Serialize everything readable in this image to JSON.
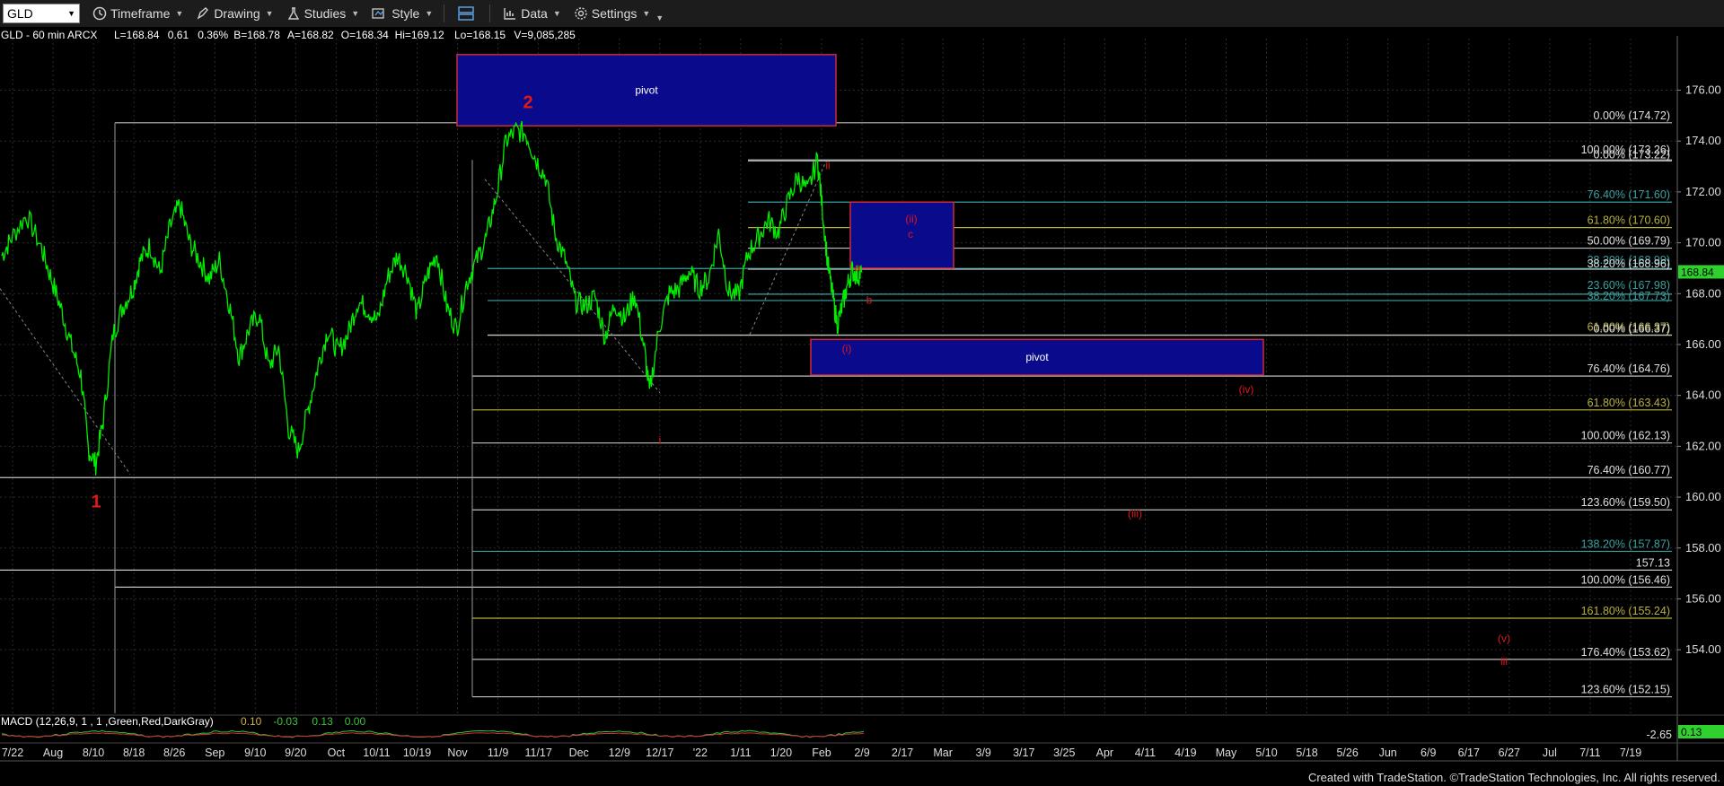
{
  "toolbar": {
    "symbol": "GLD",
    "items": [
      {
        "label": "Timeframe",
        "icon": "clock-icon"
      },
      {
        "label": "Drawing",
        "icon": "pen-icon"
      },
      {
        "label": "Studies",
        "icon": "flask-icon"
      },
      {
        "label": "Style",
        "icon": "style-icon"
      },
      {
        "label": "Data",
        "icon": "chart-icon"
      },
      {
        "label": "Settings",
        "icon": "gear-icon"
      }
    ]
  },
  "header": {
    "symbol_info": "GLD - 60 min  ARCX",
    "stats": [
      {
        "text": "L=168.84",
        "color": "#ffffff"
      },
      {
        "text": "0.61",
        "color": "#ffffff"
      },
      {
        "text": "0.36%",
        "color": "#ffffff"
      },
      {
        "text": "B=168.78",
        "color": "#ffffff"
      },
      {
        "text": "A=168.82",
        "color": "#ffffff"
      },
      {
        "text": "O=168.34",
        "color": "#ffffff"
      },
      {
        "text": "Hi=169.12",
        "color": "#ffffff"
      },
      {
        "text": "Lo=168.15",
        "color": "#ffffff"
      },
      {
        "text": "V=9,085,285",
        "color": "#ffffff"
      }
    ]
  },
  "footer": {
    "credit": "Created with TradeStation. ©TradeStation Technologies, Inc. All rights reserved."
  },
  "macd": {
    "label": "MACD (12,26,9, 1 , 1 ,Green,Red,DarkGray)",
    "values": [
      {
        "text": "0.10",
        "color": "#d0b040"
      },
      {
        "text": "-0.03",
        "color": "#3cc23c"
      },
      {
        "text": "0.13",
        "color": "#3cc23c"
      },
      {
        "text": "0.00",
        "color": "#3cc23c"
      }
    ],
    "scale_label": "-2.65",
    "last_value": "0.13"
  },
  "colors": {
    "price": "#00ee00",
    "pivot_fill": "#0a0a8c",
    "pivot_border": "#cc2a3a",
    "wave": "#e01818",
    "axis_text": "#dddddd",
    "fib_gray": "#c0c0c0",
    "fib_teal": "#3aa0a0",
    "fib_olive": "#b8b040",
    "last_price_bg": "#2fd12f"
  },
  "chart_data": {
    "type": "line",
    "title": "GLD - 60 min",
    "y_axis": {
      "range": [
        151.5,
        177.5
      ],
      "ticks": [
        "176.00",
        "174.00",
        "172.00",
        "170.00",
        "168.00",
        "166.00",
        "164.00",
        "162.00",
        "160.00",
        "158.00",
        "156.00",
        "154.00"
      ],
      "last_price": "168.84",
      "extra_label": "157.13"
    },
    "x_axis": {
      "ticks": [
        "7/22",
        "Aug",
        "8/10",
        "8/18",
        "8/26",
        "Sep",
        "9/10",
        "9/20",
        "Oct",
        "10/11",
        "10/19",
        "Nov",
        "11/9",
        "11/17",
        "Dec",
        "12/9",
        "12/17",
        "'22",
        "1/11",
        "1/20",
        "Feb",
        "2/9",
        "2/17",
        "Mar",
        "3/9",
        "3/17",
        "3/25",
        "Apr",
        "4/11",
        "4/19",
        "May",
        "5/10",
        "5/18",
        "5/26",
        "Jun",
        "6/9",
        "6/17",
        "6/27",
        "Jul",
        "7/11",
        "7/19"
      ]
    },
    "price_series": {
      "name": "GLD",
      "points": [
        [
          0,
          169.5
        ],
        [
          0.02,
          170.2
        ],
        [
          0.05,
          171.1
        ],
        [
          0.08,
          169.8
        ],
        [
          0.1,
          168.6
        ],
        [
          0.12,
          167.4
        ],
        [
          0.14,
          166.0
        ],
        [
          0.16,
          164.8
        ],
        [
          0.175,
          161.9
        ],
        [
          0.19,
          161.3
        ],
        [
          0.205,
          163.0
        ],
        [
          0.225,
          166.4
        ],
        [
          0.245,
          167.5
        ],
        [
          0.265,
          168.2
        ],
        [
          0.28,
          169.3
        ],
        [
          0.3,
          169.9
        ],
        [
          0.32,
          168.8
        ],
        [
          0.34,
          170.6
        ],
        [
          0.36,
          171.5
        ],
        [
          0.38,
          170.0
        ],
        [
          0.4,
          169.3
        ],
        [
          0.42,
          168.6
        ],
        [
          0.44,
          169.3
        ],
        [
          0.46,
          167.6
        ],
        [
          0.48,
          165.5
        ],
        [
          0.5,
          166.6
        ],
        [
          0.52,
          167.2
        ],
        [
          0.54,
          165.1
        ],
        [
          0.56,
          165.9
        ],
        [
          0.58,
          162.7
        ],
        [
          0.6,
          161.8
        ],
        [
          0.62,
          163.5
        ],
        [
          0.64,
          165.2
        ],
        [
          0.66,
          166.6
        ],
        [
          0.68,
          165.7
        ],
        [
          0.7,
          166.4
        ],
        [
          0.72,
          167.7
        ],
        [
          0.74,
          167.4
        ],
        [
          0.76,
          166.9
        ],
        [
          0.78,
          168.6
        ],
        [
          0.8,
          169.5
        ],
        [
          0.82,
          168.8
        ],
        [
          0.84,
          167.2
        ],
        [
          0.86,
          168.7
        ],
        [
          0.88,
          169.6
        ],
        [
          0.9,
          167.5
        ],
        [
          0.92,
          166.6
        ],
        [
          0.94,
          168.4
        ],
        [
          0.96,
          169.3
        ],
        [
          0.98,
          170.2
        ],
        [
          1.0,
          171.8
        ],
        [
          1.02,
          174.0
        ],
        [
          1.04,
          174.4
        ],
        [
          1.06,
          174.3
        ],
        [
          1.08,
          173.3
        ],
        [
          1.1,
          172.6
        ],
        [
          1.12,
          170.3
        ],
        [
          1.14,
          169.3
        ],
        [
          1.16,
          167.7
        ],
        [
          1.18,
          167.5
        ],
        [
          1.2,
          167.9
        ],
        [
          1.22,
          166.3
        ],
        [
          1.24,
          167.6
        ],
        [
          1.26,
          167.0
        ],
        [
          1.28,
          168.0
        ],
        [
          1.3,
          165.8
        ],
        [
          1.31,
          164.1
        ],
        [
          1.33,
          166.7
        ],
        [
          1.35,
          168.0
        ],
        [
          1.37,
          168.2
        ],
        [
          1.39,
          168.9
        ],
        [
          1.41,
          168.2
        ],
        [
          1.43,
          168.6
        ],
        [
          1.45,
          170.4
        ],
        [
          1.47,
          168.1
        ],
        [
          1.49,
          167.9
        ],
        [
          1.51,
          169.6
        ],
        [
          1.53,
          170.2
        ],
        [
          1.55,
          170.9
        ],
        [
          1.57,
          170.4
        ],
        [
          1.59,
          171.6
        ],
        [
          1.61,
          172.6
        ],
        [
          1.63,
          172.0
        ],
        [
          1.65,
          173.3
        ],
        [
          1.66,
          171.3
        ],
        [
          1.67,
          169.3
        ],
        [
          1.68,
          168.0
        ],
        [
          1.69,
          166.8
        ],
        [
          1.7,
          167.5
        ],
        [
          1.71,
          168.3
        ],
        [
          1.72,
          168.9
        ],
        [
          1.73,
          168.7
        ],
        [
          1.74,
          168.84
        ]
      ]
    },
    "fib_levels": [
      {
        "label": "0.00% (174.72)",
        "value": 174.72,
        "color": "#c0c0c0"
      },
      {
        "label": "100.00% (173.26)",
        "value": 173.26,
        "color": "#c0c0c0"
      },
      {
        "label": "0.00% (173.22)",
        "value": 173.22,
        "color": "#c0c0c0"
      },
      {
        "label": "76.40% (171.60)",
        "value": 171.6,
        "color": "#3aa0a0"
      },
      {
        "label": "61.80% (170.60)",
        "value": 170.6,
        "color": "#b8b040"
      },
      {
        "label": "50.00% (169.79)",
        "value": 169.79,
        "color": "#c0c0c0"
      },
      {
        "label": "38.20% (168.99)",
        "value": 168.99,
        "color": "#3aa0a0"
      },
      {
        "label": "38.20% (168.96)",
        "value": 168.96,
        "color": "#c0c0c0"
      },
      {
        "label": "23.60% (167.98)",
        "value": 167.98,
        "color": "#3aa0a0"
      },
      {
        "label": "38.20% (167.73)",
        "value": 167.73,
        "color": "#3aa0a0"
      },
      {
        "label": "61.80% (166.37)",
        "value": 166.37,
        "color": "#b8b040"
      },
      {
        "label": "0.00% (166.37)",
        "value": 166.37,
        "color": "#c0c0c0"
      },
      {
        "label": "76.40% (164.76)",
        "value": 164.76,
        "color": "#c0c0c0"
      },
      {
        "label": "61.80% (163.43)",
        "value": 163.43,
        "color": "#b8b040"
      },
      {
        "label": "100.00% (162.13)",
        "value": 162.13,
        "color": "#c0c0c0"
      },
      {
        "label": "76.40% (160.77)",
        "value": 160.77,
        "color": "#c0c0c0"
      },
      {
        "label": "123.60% (159.50)",
        "value": 159.5,
        "color": "#c0c0c0"
      },
      {
        "label": "138.20% (157.87)",
        "value": 157.87,
        "color": "#3aa0a0"
      },
      {
        "label": "100.00% (156.46)",
        "value": 156.46,
        "color": "#c0c0c0"
      },
      {
        "label": "161.80% (155.24)",
        "value": 155.24,
        "color": "#b8b040"
      },
      {
        "label": "176.40% (153.62)",
        "value": 153.62,
        "color": "#c0c0c0"
      },
      {
        "label": "123.60% (152.15)",
        "value": 152.15,
        "color": "#c0c0c0"
      }
    ],
    "pivot_zones": [
      {
        "label": "pivot",
        "top": 177.4,
        "bottom": 174.6
      },
      {
        "label": "pivot",
        "top": 166.2,
        "bottom": 164.8
      },
      {
        "label": "",
        "top": 171.6,
        "bottom": 169.0
      }
    ],
    "wave_labels": [
      {
        "text": "1",
        "big": true
      },
      {
        "text": "2",
        "big": true
      },
      {
        "text": "ii",
        "big": false
      },
      {
        "text": "(ii)",
        "big": false
      },
      {
        "text": "c",
        "big": false
      },
      {
        "text": "a",
        "big": false
      },
      {
        "text": "b",
        "big": false
      },
      {
        "text": "(i)",
        "big": false
      },
      {
        "text": "(iv)",
        "big": false
      },
      {
        "text": "i",
        "big": false
      },
      {
        "text": "(iii)",
        "big": false
      },
      {
        "text": "(v)",
        "big": false
      },
      {
        "text": "iii",
        "big": false
      }
    ]
  }
}
